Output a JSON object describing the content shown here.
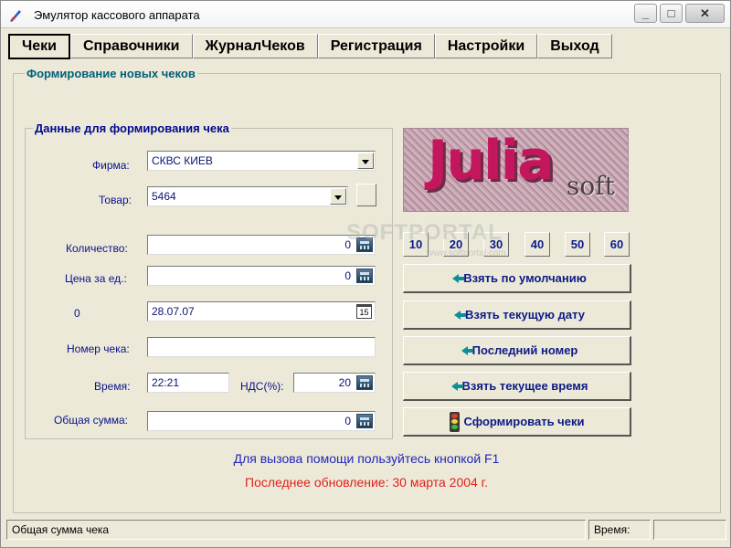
{
  "window": {
    "title": "Эмулятор кассового аппарата",
    "buttons": {
      "minimize": "_",
      "maximize": "□",
      "close": "✕"
    }
  },
  "menu": [
    {
      "label": "Чеки",
      "active": true
    },
    {
      "label": "Справочники",
      "active": false
    },
    {
      "label": "ЖурналЧеков",
      "active": false
    },
    {
      "label": "Регистрация",
      "active": false
    },
    {
      "label": "Настройки",
      "active": false
    },
    {
      "label": "Выход",
      "active": false
    }
  ],
  "main_group": {
    "title": "Формирование новых чеков"
  },
  "data_group": {
    "title": "Данные для формирования чека",
    "firm": {
      "label": "Фирма:",
      "value": "СКВС КИЕВ"
    },
    "product": {
      "label": "Товар:",
      "value": "5464"
    },
    "quantity": {
      "label": "Количество:",
      "value": "0"
    },
    "price": {
      "label": "Цена за ед.:",
      "value": "0"
    },
    "date": {
      "label": "0",
      "value": "28.07.07",
      "calendar_day": "15"
    },
    "receipt_number": {
      "label": "Номер чека:",
      "value": ""
    },
    "time": {
      "label": "Время:",
      "value": "22:21"
    },
    "vat": {
      "label": "НДС(%):",
      "value": "20"
    },
    "total": {
      "label": "Общая сумма:",
      "value": "0"
    }
  },
  "logo": {
    "main": "Julia",
    "sub": "soft"
  },
  "quantity_presets": [
    "10",
    "20",
    "30",
    "40",
    "50",
    "60"
  ],
  "actions": {
    "default": "Взять по умолчанию",
    "current_date": "Взять текущую дату",
    "last_number": "Последний номер",
    "current_time": "Взять текущее время",
    "generate": "Сформировать чеки"
  },
  "help_text": "Для вызова помощи пользуйтесь кнопкой F1",
  "update_text": "Последнее обновление: 30 марта 2004 г.",
  "status": {
    "left": "Общая сумма чека",
    "time_label": "Время:"
  },
  "watermark": {
    "main": "SOFTPORTAL",
    "sub": "www.softportal.com"
  }
}
